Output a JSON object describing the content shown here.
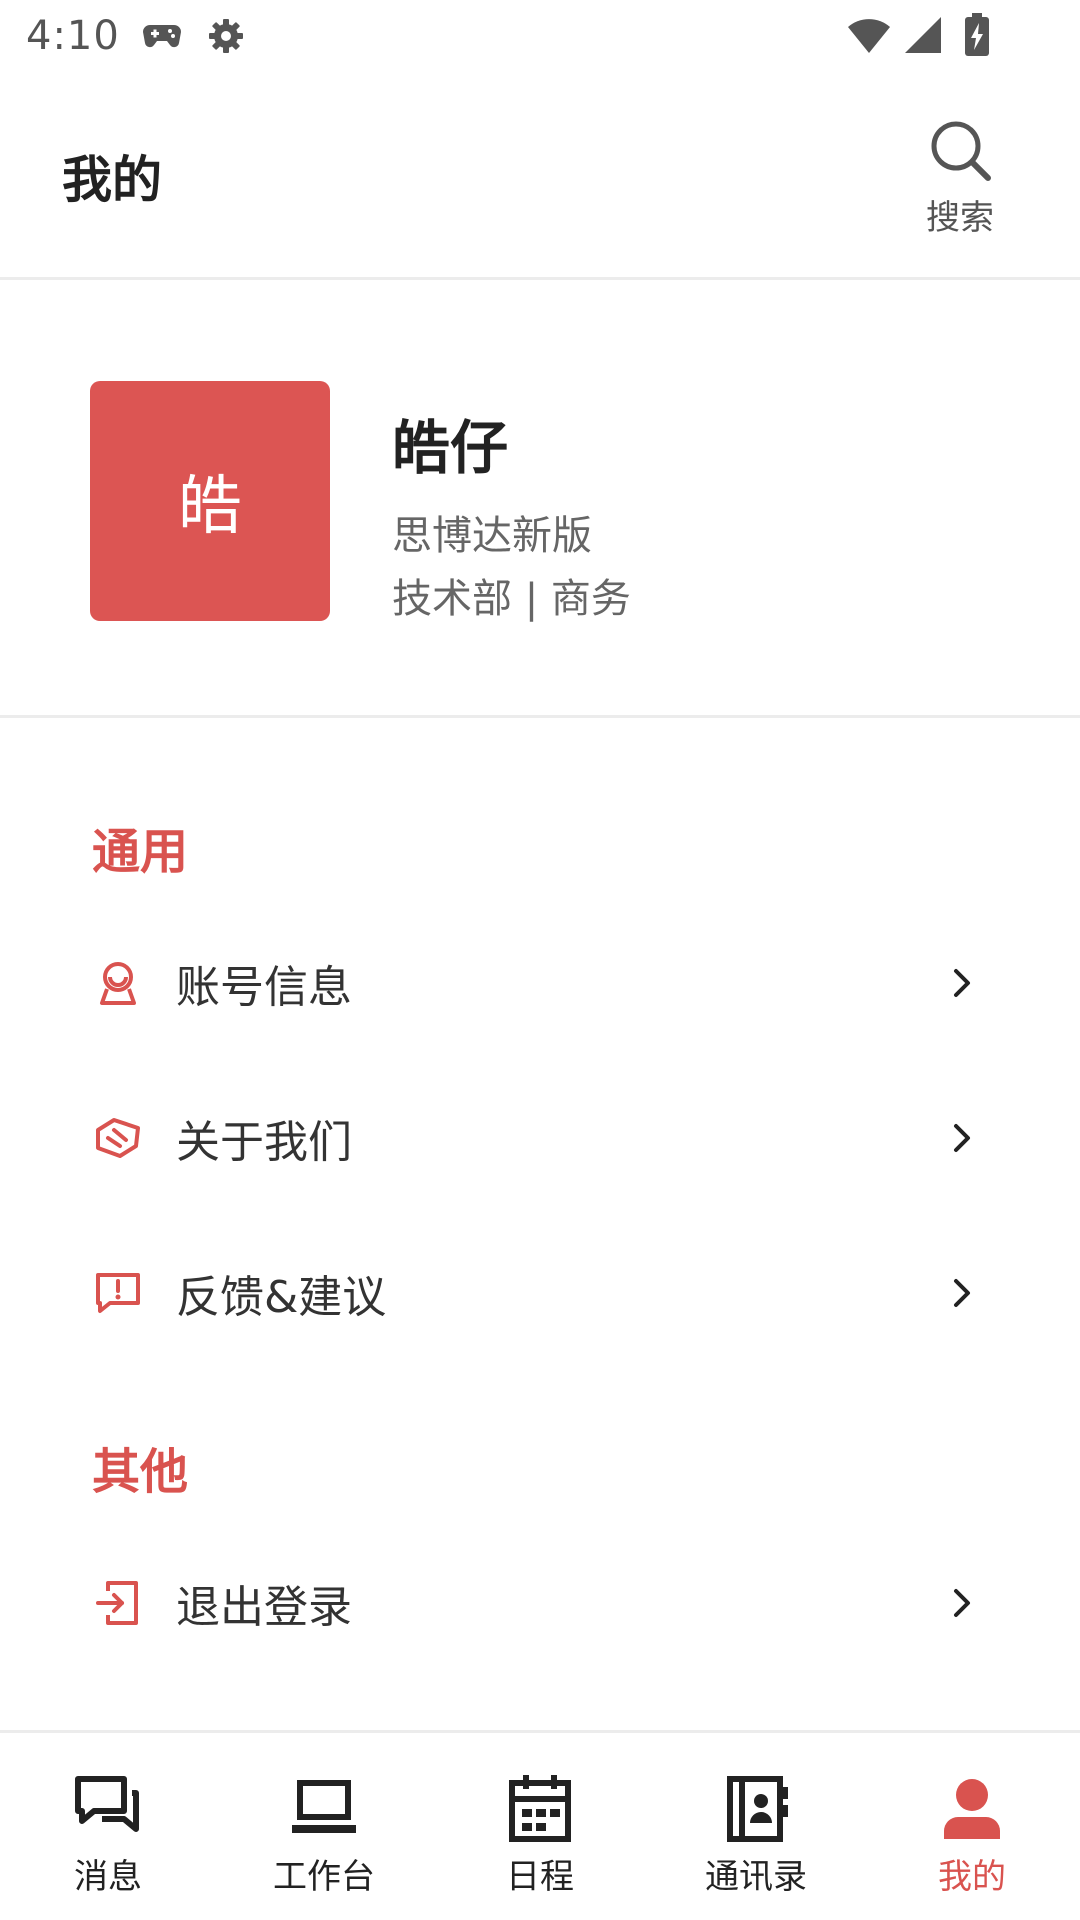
{
  "status_bar": {
    "time": "4:10"
  },
  "header": {
    "title": "我的",
    "search_label": "搜索"
  },
  "profile": {
    "avatar_text": "皓",
    "name": "皓仔",
    "company": "思博达新版",
    "department": "技术部 | 商务"
  },
  "sections": [
    {
      "title": "通用",
      "items": [
        {
          "label": "账号信息",
          "icon": "account-icon"
        },
        {
          "label": "关于我们",
          "icon": "handshake-icon"
        },
        {
          "label": "反馈&建议",
          "icon": "feedback-icon"
        }
      ]
    },
    {
      "title": "其他",
      "items": [
        {
          "label": "退出登录",
          "icon": "logout-icon"
        }
      ]
    }
  ],
  "bottom_nav": [
    {
      "label": "消息",
      "icon": "messages-icon",
      "active": false
    },
    {
      "label": "工作台",
      "icon": "laptop-icon",
      "active": false
    },
    {
      "label": "日程",
      "icon": "calendar-icon",
      "active": false
    },
    {
      "label": "通讯录",
      "icon": "contacts-icon",
      "active": false
    },
    {
      "label": "我的",
      "icon": "person-icon",
      "active": true
    }
  ],
  "colors": {
    "accent": "#d9534f",
    "avatar_bg": "#dc5553",
    "text_primary": "#222222",
    "text_secondary": "#666666"
  }
}
